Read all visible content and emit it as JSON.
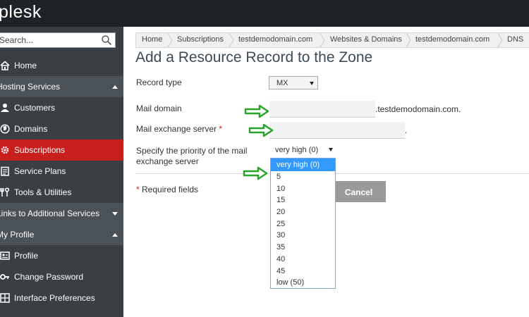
{
  "app": {
    "logo": "plesk"
  },
  "sidebar": {
    "search_placeholder": "Search...",
    "items": [
      {
        "label": "Home",
        "icon": "home-icon",
        "type": "item"
      },
      {
        "label": "Hosting Services",
        "icon": "",
        "type": "section",
        "caret": "up"
      },
      {
        "label": "Customers",
        "icon": "user-icon",
        "type": "item"
      },
      {
        "label": "Domains",
        "icon": "globe-icon",
        "type": "item"
      },
      {
        "label": "Subscriptions",
        "icon": "gear-icon",
        "type": "item",
        "active": true
      },
      {
        "label": "Service Plans",
        "icon": "clipboard-icon",
        "type": "item"
      },
      {
        "label": "Tools & Utilities",
        "icon": "tools-icon",
        "type": "item"
      },
      {
        "label": "Links to Additional Services",
        "icon": "",
        "type": "section",
        "caret": "down"
      },
      {
        "label": "My Profile",
        "icon": "",
        "type": "section",
        "caret": "up"
      },
      {
        "label": "Profile",
        "icon": "profile-card-icon",
        "type": "item"
      },
      {
        "label": "Change Password",
        "icon": "key-icon",
        "type": "item"
      },
      {
        "label": "Interface Preferences",
        "icon": "grid-icon",
        "type": "item"
      }
    ]
  },
  "breadcrumb": [
    "Home",
    "Subscriptions",
    "testdemodomain.com",
    "Websites & Domains",
    "testdemodomain.com",
    "DNS"
  ],
  "page_title": "Add a Resource Record to the Zone",
  "form": {
    "record_type_label": "Record type",
    "record_type_value": "MX",
    "mail_domain_label": "Mail domain",
    "mail_domain_value": "",
    "mail_domain_suffix": ".testdemodomain.com.",
    "mail_exchange_label": "Mail exchange server",
    "mail_exchange_required": "*",
    "mail_exchange_value": "",
    "mail_exchange_suffix": ".",
    "priority_label_line1": "Specify the priority of the mail",
    "priority_label_line2": "exchange server",
    "priority_value": "very high (0)",
    "priority_options": [
      "very high (0)",
      "5",
      "10",
      "15",
      "20",
      "25",
      "30",
      "35",
      "40",
      "45",
      "low (50)"
    ],
    "required_star": "*",
    "required_note": "Required fields",
    "cancel_label": "Cancel"
  },
  "colors": {
    "topbar": "#1f2326",
    "sidebar": "#3a3f44",
    "active": "#c81e1e",
    "highlight": "#3399ff",
    "arrow": "#2aa32a"
  }
}
